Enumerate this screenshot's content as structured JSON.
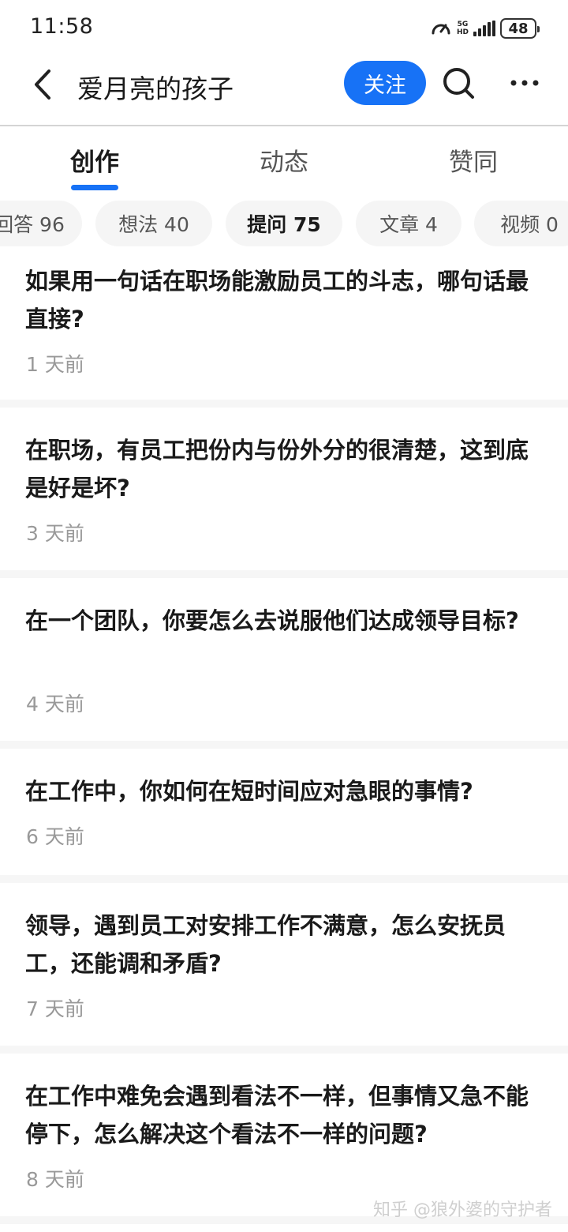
{
  "status_bar": {
    "time": "11:58",
    "network_top": "5G",
    "network_bottom": "HD",
    "battery": "48",
    "icons": [
      "speed-icon",
      "signal-icon",
      "battery-icon"
    ]
  },
  "header": {
    "title": "爱月亮的孩子",
    "follow_label": "关注",
    "icons": [
      "chevron-left-icon",
      "search-icon",
      "more-icon"
    ]
  },
  "main_tabs": [
    {
      "label": "创作",
      "active": true
    },
    {
      "label": "动态",
      "active": false
    },
    {
      "label": "赞同",
      "active": false
    }
  ],
  "sub_tabs": [
    {
      "label": "回答 96",
      "active": false
    },
    {
      "label": "想法 40",
      "active": false
    },
    {
      "label": "提问 75",
      "active": true
    },
    {
      "label": "文章 4",
      "active": false
    },
    {
      "label": "视频 0",
      "active": false
    }
  ],
  "questions": [
    {
      "title": "如果用一句话在职场能激励员工的斗志，哪句话最直接?",
      "time": "1 天前"
    },
    {
      "title": "在职场，有员工把份内与份外分的很清楚，这到底是好是坏?",
      "time": "3 天前"
    },
    {
      "title": "在一个团队，你要怎么去说服他们达成领导目标?",
      "time": "4 天前"
    },
    {
      "title": "在工作中，你如何在短时间应对急眼的事情?",
      "time": "6 天前"
    },
    {
      "title": "领导，遇到员工对安排工作不满意，怎么安抚员工，还能调和矛盾?",
      "time": "7 天前"
    },
    {
      "title": "在工作中难免会遇到看法不一样，但事情又急不能停下，怎么解决这个看法不一样的问题?",
      "time": "8 天前"
    }
  ],
  "watermark": "知乎 @狼外婆的守护者",
  "colors": {
    "accent": "#1772f6",
    "muted_text": "#999999",
    "divider": "#f6f6f6"
  }
}
